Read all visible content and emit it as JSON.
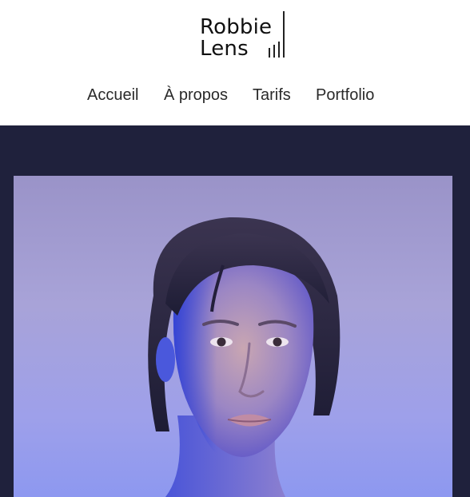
{
  "brand": {
    "line1": "Robbie",
    "line2": "Lens",
    "logo_icon": "camera-bars-icon"
  },
  "nav": {
    "items": [
      {
        "label": "Accueil"
      },
      {
        "label": "À propos"
      },
      {
        "label": "Tarifs"
      },
      {
        "label": "Portfolio"
      }
    ]
  },
  "hero": {
    "background_color": "#1f213c",
    "image": "portrait-photo"
  },
  "colors": {
    "header_bg": "#ffffff",
    "nav_text": "#2a2a2a",
    "hero_bg": "#1f213c",
    "photo_bg": "#a3a0e0"
  }
}
